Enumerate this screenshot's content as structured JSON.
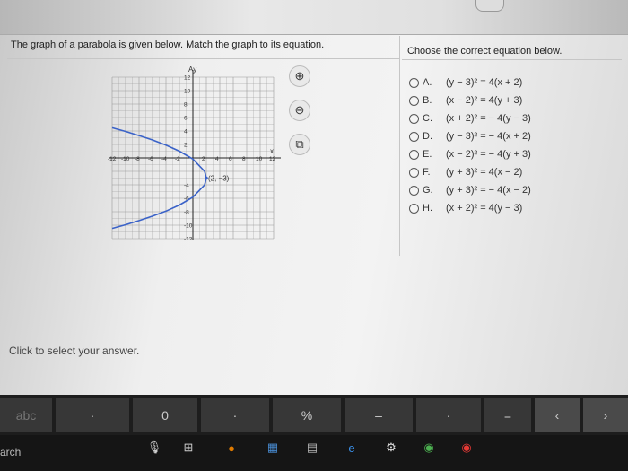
{
  "question": "The graph of a parabola is given below. Match the graph to its equation.",
  "choose": "Choose the correct equation below.",
  "options": [
    {
      "letter": "A.",
      "eq": "(y − 3)² = 4(x + 2)"
    },
    {
      "letter": "B.",
      "eq": "(x − 2)² = 4(y + 3)"
    },
    {
      "letter": "C.",
      "eq": "(x + 2)² = − 4(y − 3)"
    },
    {
      "letter": "D.",
      "eq": "(y − 3)² = − 4(x + 2)"
    },
    {
      "letter": "E.",
      "eq": "(x − 2)² = − 4(y + 3)"
    },
    {
      "letter": "F.",
      "eq": "(y + 3)² = 4(x − 2)"
    },
    {
      "letter": "G.",
      "eq": "(y + 3)² = − 4(x − 2)"
    },
    {
      "letter": "H.",
      "eq": "(x + 2)² = 4(y − 3)"
    }
  ],
  "click_prompt": "Click to select your answer.",
  "graph": {
    "y_axis_label": "Ay",
    "x_axis_label": "x",
    "x_ticks": [
      "-12",
      "-10",
      "-8",
      "-6",
      "-4",
      "-2",
      "2",
      "4",
      "6",
      "8",
      "10",
      "12"
    ],
    "y_ticks": [
      "12",
      "10",
      "8",
      "6",
      "4",
      "2",
      "-4",
      "-6",
      "-8",
      "-10",
      "-12"
    ],
    "vertex_label": "(2, −3)"
  },
  "chart_data": {
    "type": "line",
    "title": "",
    "xlabel": "x",
    "ylabel": "y",
    "xlim": [
      -12,
      12
    ],
    "ylim": [
      -12,
      12
    ],
    "grid": true,
    "vertex": [
      2,
      -3
    ],
    "equation_shown": "parabola opening left, vertex (2, -3)",
    "series": [
      {
        "x": [
          -12,
          -10,
          -8,
          -6,
          -4,
          -2,
          0,
          1.75,
          2,
          1.75,
          0,
          -2,
          -4,
          -6,
          -8,
          -10,
          -12
        ],
        "y": [
          4.48,
          3.93,
          3.32,
          2.66,
          1.9,
          1.0,
          -0.17,
          -2,
          -3,
          -4,
          -5.83,
          -7.0,
          -7.9,
          -8.66,
          -9.32,
          -9.93,
          -10.48
        ]
      }
    ]
  },
  "keyboard": {
    "abc": "abc",
    "zero": "0",
    "percent": "%",
    "equals": "="
  },
  "taskbar": {
    "search": "arch"
  },
  "colors": {
    "curve": "#3a62c8",
    "grid": "#9a9a9a",
    "radio": "#555555"
  }
}
